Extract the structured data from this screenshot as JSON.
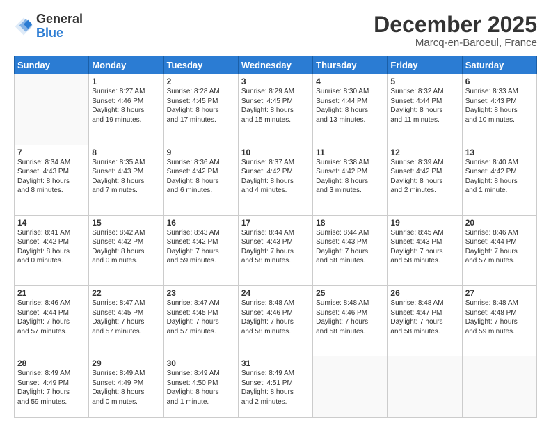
{
  "header": {
    "logo_general": "General",
    "logo_blue": "Blue",
    "month_title": "December 2025",
    "location": "Marcq-en-Baroeul, France"
  },
  "calendar": {
    "days_of_week": [
      "Sunday",
      "Monday",
      "Tuesday",
      "Wednesday",
      "Thursday",
      "Friday",
      "Saturday"
    ],
    "weeks": [
      [
        {
          "day": "",
          "info": ""
        },
        {
          "day": "1",
          "info": "Sunrise: 8:27 AM\nSunset: 4:46 PM\nDaylight: 8 hours\nand 19 minutes."
        },
        {
          "day": "2",
          "info": "Sunrise: 8:28 AM\nSunset: 4:45 PM\nDaylight: 8 hours\nand 17 minutes."
        },
        {
          "day": "3",
          "info": "Sunrise: 8:29 AM\nSunset: 4:45 PM\nDaylight: 8 hours\nand 15 minutes."
        },
        {
          "day": "4",
          "info": "Sunrise: 8:30 AM\nSunset: 4:44 PM\nDaylight: 8 hours\nand 13 minutes."
        },
        {
          "day": "5",
          "info": "Sunrise: 8:32 AM\nSunset: 4:44 PM\nDaylight: 8 hours\nand 11 minutes."
        },
        {
          "day": "6",
          "info": "Sunrise: 8:33 AM\nSunset: 4:43 PM\nDaylight: 8 hours\nand 10 minutes."
        }
      ],
      [
        {
          "day": "7",
          "info": "Sunrise: 8:34 AM\nSunset: 4:43 PM\nDaylight: 8 hours\nand 8 minutes."
        },
        {
          "day": "8",
          "info": "Sunrise: 8:35 AM\nSunset: 4:43 PM\nDaylight: 8 hours\nand 7 minutes."
        },
        {
          "day": "9",
          "info": "Sunrise: 8:36 AM\nSunset: 4:42 PM\nDaylight: 8 hours\nand 6 minutes."
        },
        {
          "day": "10",
          "info": "Sunrise: 8:37 AM\nSunset: 4:42 PM\nDaylight: 8 hours\nand 4 minutes."
        },
        {
          "day": "11",
          "info": "Sunrise: 8:38 AM\nSunset: 4:42 PM\nDaylight: 8 hours\nand 3 minutes."
        },
        {
          "day": "12",
          "info": "Sunrise: 8:39 AM\nSunset: 4:42 PM\nDaylight: 8 hours\nand 2 minutes."
        },
        {
          "day": "13",
          "info": "Sunrise: 8:40 AM\nSunset: 4:42 PM\nDaylight: 8 hours\nand 1 minute."
        }
      ],
      [
        {
          "day": "14",
          "info": "Sunrise: 8:41 AM\nSunset: 4:42 PM\nDaylight: 8 hours\nand 0 minutes."
        },
        {
          "day": "15",
          "info": "Sunrise: 8:42 AM\nSunset: 4:42 PM\nDaylight: 8 hours\nand 0 minutes."
        },
        {
          "day": "16",
          "info": "Sunrise: 8:43 AM\nSunset: 4:42 PM\nDaylight: 7 hours\nand 59 minutes."
        },
        {
          "day": "17",
          "info": "Sunrise: 8:44 AM\nSunset: 4:43 PM\nDaylight: 7 hours\nand 58 minutes."
        },
        {
          "day": "18",
          "info": "Sunrise: 8:44 AM\nSunset: 4:43 PM\nDaylight: 7 hours\nand 58 minutes."
        },
        {
          "day": "19",
          "info": "Sunrise: 8:45 AM\nSunset: 4:43 PM\nDaylight: 7 hours\nand 58 minutes."
        },
        {
          "day": "20",
          "info": "Sunrise: 8:46 AM\nSunset: 4:44 PM\nDaylight: 7 hours\nand 57 minutes."
        }
      ],
      [
        {
          "day": "21",
          "info": "Sunrise: 8:46 AM\nSunset: 4:44 PM\nDaylight: 7 hours\nand 57 minutes."
        },
        {
          "day": "22",
          "info": "Sunrise: 8:47 AM\nSunset: 4:45 PM\nDaylight: 7 hours\nand 57 minutes."
        },
        {
          "day": "23",
          "info": "Sunrise: 8:47 AM\nSunset: 4:45 PM\nDaylight: 7 hours\nand 57 minutes."
        },
        {
          "day": "24",
          "info": "Sunrise: 8:48 AM\nSunset: 4:46 PM\nDaylight: 7 hours\nand 58 minutes."
        },
        {
          "day": "25",
          "info": "Sunrise: 8:48 AM\nSunset: 4:46 PM\nDaylight: 7 hours\nand 58 minutes."
        },
        {
          "day": "26",
          "info": "Sunrise: 8:48 AM\nSunset: 4:47 PM\nDaylight: 7 hours\nand 58 minutes."
        },
        {
          "day": "27",
          "info": "Sunrise: 8:48 AM\nSunset: 4:48 PM\nDaylight: 7 hours\nand 59 minutes."
        }
      ],
      [
        {
          "day": "28",
          "info": "Sunrise: 8:49 AM\nSunset: 4:49 PM\nDaylight: 7 hours\nand 59 minutes."
        },
        {
          "day": "29",
          "info": "Sunrise: 8:49 AM\nSunset: 4:49 PM\nDaylight: 8 hours\nand 0 minutes."
        },
        {
          "day": "30",
          "info": "Sunrise: 8:49 AM\nSunset: 4:50 PM\nDaylight: 8 hours\nand 1 minute."
        },
        {
          "day": "31",
          "info": "Sunrise: 8:49 AM\nSunset: 4:51 PM\nDaylight: 8 hours\nand 2 minutes."
        },
        {
          "day": "",
          "info": ""
        },
        {
          "day": "",
          "info": ""
        },
        {
          "day": "",
          "info": ""
        }
      ]
    ]
  }
}
